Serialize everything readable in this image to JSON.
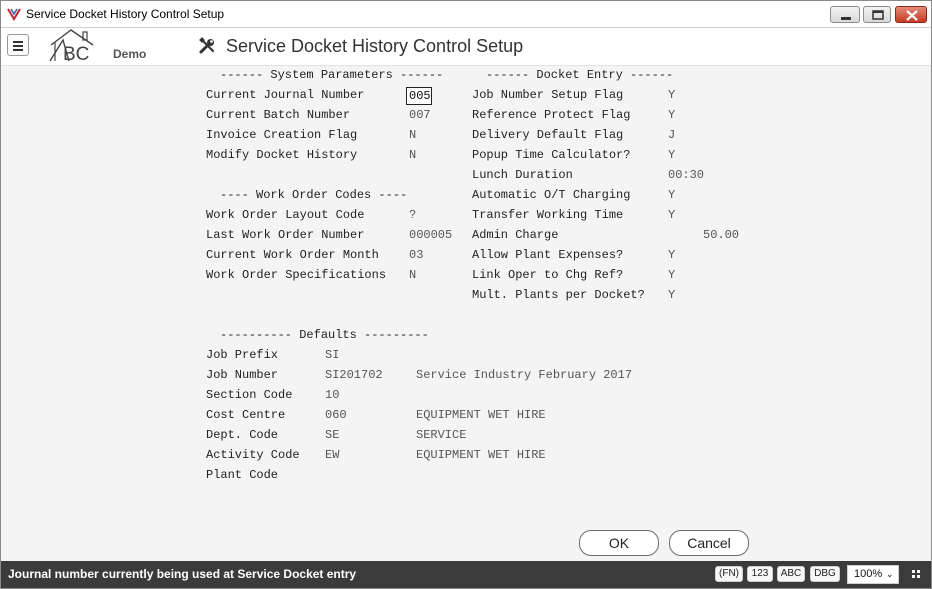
{
  "window": {
    "title": "Service Docket History Control Setup"
  },
  "toolbar": {
    "logo_letters": "BC",
    "logo_label": "Demo",
    "screen_title": "Service Docket History Control Setup"
  },
  "system_parameters": {
    "header": "------ System Parameters ------",
    "current_journal_number": {
      "label": "Current Journal Number",
      "value": "005"
    },
    "current_batch_number": {
      "label": "Current Batch Number",
      "value": "007"
    },
    "invoice_creation_flag": {
      "label": "Invoice Creation Flag",
      "value": "N"
    },
    "modify_docket_history": {
      "label": "Modify Docket History",
      "value": "N"
    }
  },
  "work_order_codes": {
    "header": "---- Work Order Codes ----",
    "layout_code": {
      "label": "Work Order Layout Code",
      "value": "?"
    },
    "last_number": {
      "label": "Last Work Order Number",
      "value": "000005"
    },
    "current_month": {
      "label": "Current Work Order Month",
      "value": "03"
    },
    "specifications": {
      "label": "Work Order Specifications",
      "value": "N"
    }
  },
  "docket_entry": {
    "header": "------ Docket Entry ------",
    "job_number_setup_flag": {
      "label": "Job Number Setup Flag",
      "value": "Y"
    },
    "reference_protect_flag": {
      "label": "Reference Protect Flag",
      "value": "Y"
    },
    "delivery_default_flag": {
      "label": "Delivery Default Flag",
      "value": "J"
    },
    "popup_time_calculator": {
      "label": "Popup Time Calculator?",
      "value": "Y"
    },
    "lunch_duration": {
      "label": "Lunch Duration",
      "value": "00:30"
    },
    "automatic_ot_charging": {
      "label": "Automatic O/T Charging",
      "value": "Y"
    },
    "transfer_working_time": {
      "label": "Transfer Working Time",
      "value": "Y"
    },
    "admin_charge": {
      "label": "Admin Charge",
      "value": "50.00"
    },
    "allow_plant_expenses": {
      "label": "Allow Plant Expenses?",
      "value": "Y"
    },
    "link_oper_to_chg_ref": {
      "label": "Link Oper to Chg Ref?",
      "value": "Y"
    },
    "mult_plants_per_docket": {
      "label": "Mult. Plants per Docket?",
      "value": "Y"
    }
  },
  "defaults": {
    "header": "---------- Defaults ---------",
    "job_prefix": {
      "label": "Job Prefix",
      "value": "SI"
    },
    "job_number": {
      "label": "Job Number",
      "value": "SI201702",
      "description": "Service Industry February 2017"
    },
    "section_code": {
      "label": "Section Code",
      "value": "10"
    },
    "cost_centre": {
      "label": "Cost Centre",
      "value": "060",
      "description": "EQUIPMENT WET HIRE"
    },
    "dept_code": {
      "label": "Dept. Code",
      "value": "SE",
      "description": "SERVICE"
    },
    "activity_code": {
      "label": "Activity Code",
      "value": "EW",
      "description": "EQUIPMENT WET HIRE"
    },
    "plant_code": {
      "label": "Plant Code",
      "value": ""
    }
  },
  "buttons": {
    "ok": "OK",
    "cancel": "Cancel"
  },
  "statusbar": {
    "message": "Journal number currently being used at Service Docket entry",
    "fn": "(FN)",
    "num": "123",
    "abc": "ABC",
    "dbg": "DBG",
    "zoom": "100%"
  },
  "colors": {
    "statusbar_bg": "#3b3b3b",
    "close_button": "#c43b22",
    "logo_red": "#c0272d",
    "form_bg": "#f4f4f4"
  },
  "icons": {
    "app": "app-logo-icon",
    "menu": "hamburger-menu-icon",
    "tools": "tools-wrench-screwdriver-icon",
    "minimize": "minimize-icon",
    "maximize": "maximize-icon",
    "close": "close-icon",
    "grip": "resize-grip-icon"
  }
}
